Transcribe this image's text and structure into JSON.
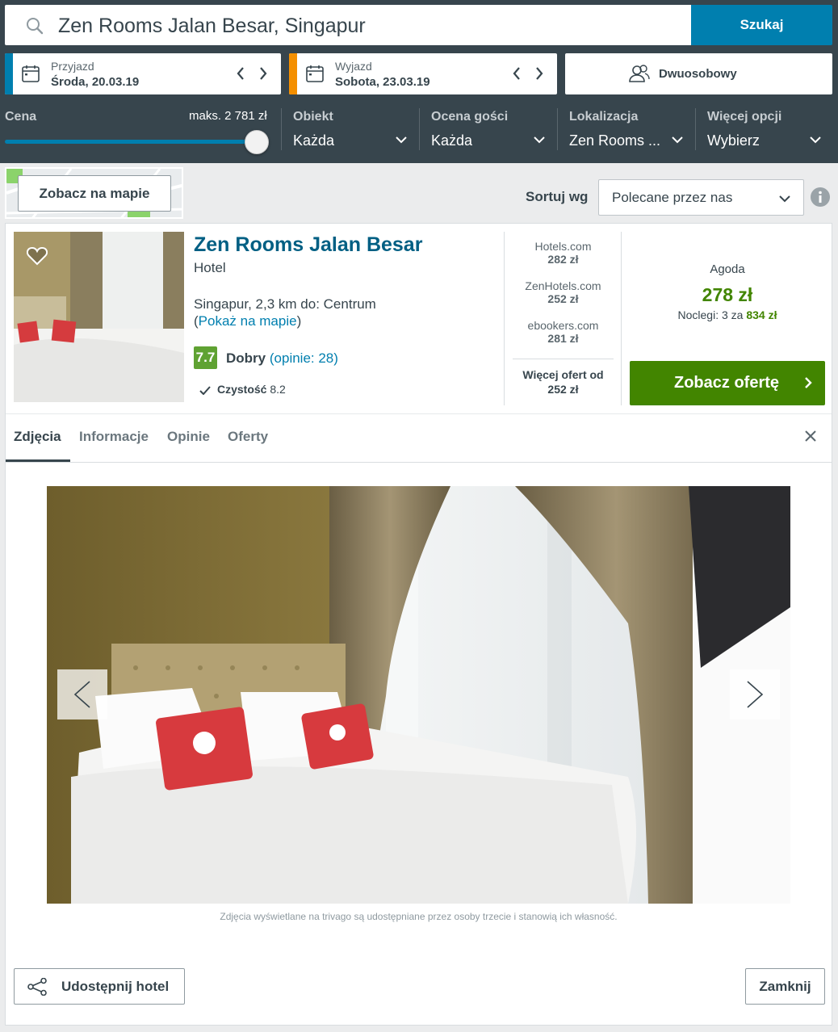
{
  "search": {
    "query": "Zen Rooms Jalan Besar, Singapur",
    "button_label": "Szukaj"
  },
  "dates": {
    "checkin": {
      "label": "Przyjazd",
      "value": "Środa, 20.03.19"
    },
    "checkout": {
      "label": "Wyjazd",
      "value": "Sobota, 23.03.19"
    }
  },
  "room": {
    "label": "Dwuosobowy"
  },
  "filters": {
    "price": {
      "label": "Cena",
      "max_label": "maks. 2 781 zł",
      "slider_fraction": 1.0
    },
    "property": {
      "label": "Obiekt",
      "value": "Każda"
    },
    "guest_rating": {
      "label": "Ocena gości",
      "value": "Każda"
    },
    "location": {
      "label": "Lokalizacja",
      "value": "Zen Rooms ..."
    },
    "more": {
      "label": "Więcej opcji",
      "value": "Wybierz"
    }
  },
  "map_button": "Zobacz na mapie",
  "sort": {
    "label": "Sortuj wg",
    "value": "Polecane przez nas"
  },
  "hotel": {
    "name": "Zen Rooms Jalan Besar",
    "type": "Hotel",
    "location": "Singapur, 2,3 km do: Centrum",
    "map_paren_open": "(",
    "map_link": "Pokaż na mapie",
    "map_paren_close": ")",
    "rating_score": "7.7",
    "rating_word": "Dobry",
    "reviews_open": "(",
    "reviews_link": "opinie: 28",
    "reviews_close": ")",
    "cleanliness_label": "Czystość",
    "cleanliness_score": "8.2"
  },
  "deals": [
    {
      "site": "Hotels.com",
      "price": "282 zł"
    },
    {
      "site": "ZenHotels.com",
      "price": "252 zł"
    },
    {
      "site": "ebookers.com",
      "price": "281 zł"
    }
  ],
  "more_deals": {
    "line1": "Więcej ofert od",
    "line2": "252 zł"
  },
  "best_deal": {
    "site": "Agoda",
    "price": "278 zł",
    "total_prefix": "Noclegi: 3 za ",
    "total_price": "834 zł",
    "button_label": "Zobacz ofertę"
  },
  "tabs": [
    "Zdjęcia",
    "Informacje",
    "Opinie",
    "Oferty"
  ],
  "active_tab": "Zdjęcia",
  "disclaimer": "Zdjęcia wyświetlane na trivago są udostępniane przez osoby trzecie i stanowią ich własność.",
  "footer": {
    "share_label": "Udostępnij hotel",
    "close_label": "Zamknij"
  },
  "colors": {
    "header_bg": "#37454d",
    "search_button": "#007faf",
    "checkin_accent": "#007faf",
    "checkout_accent": "#f48f00",
    "deal_green": "#428500",
    "rating_green": "#5fa232",
    "link_blue": "#007faf",
    "hotel_name": "#005f83"
  },
  "icons": [
    "search-icon",
    "calendar-icon",
    "chevron-left-icon",
    "chevron-right-icon",
    "users-icon",
    "chevron-down-icon",
    "info-icon",
    "heart-icon",
    "check-icon",
    "close-icon",
    "share-icon"
  ]
}
